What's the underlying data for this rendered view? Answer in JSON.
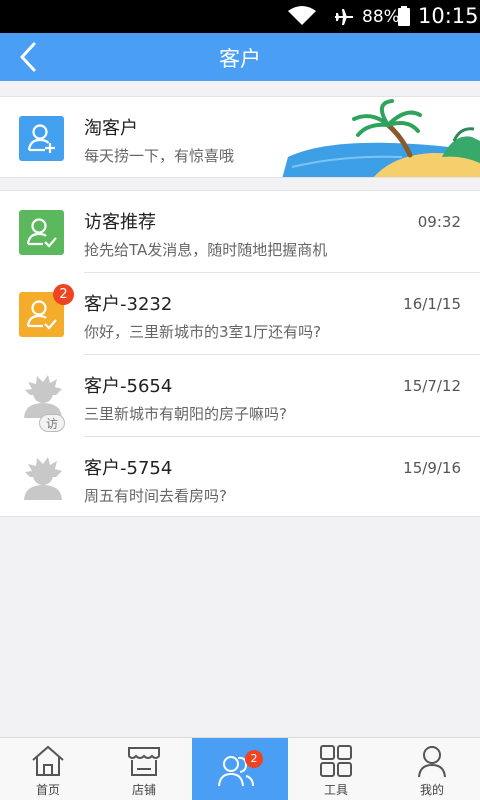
{
  "status_bar": {
    "battery": "88%",
    "time": "10:15"
  },
  "navbar": {
    "title": "客户"
  },
  "tao": {
    "name": "淘客户",
    "desc": "每天捞一下，有惊喜哦"
  },
  "list": [
    {
      "name": "访客推荐",
      "msg": "抢先给TA发消息，随时随地把握商机",
      "time": "09:32"
    },
    {
      "name": "客户-3232",
      "msg": "你好，三里新城市的3室1厅还有吗?",
      "time": "16/1/15",
      "badge": "2"
    },
    {
      "name": "客户-5654",
      "msg": "三里新城市有朝阳的房子嘛吗?",
      "time": "15/7/12",
      "tag": "访"
    },
    {
      "name": "客户-5754",
      "msg": "周五有时间去看房吗?",
      "time": "15/9/16"
    }
  ],
  "tabs": [
    {
      "label": "首页"
    },
    {
      "label": "店铺"
    },
    {
      "label": "",
      "badge": "2"
    },
    {
      "label": "工具"
    },
    {
      "label": "我的"
    }
  ],
  "colors": {
    "primary": "#4a9ff5",
    "green": "#5cb85c",
    "orange": "#f4ad2b",
    "badge": "#ee4422"
  }
}
